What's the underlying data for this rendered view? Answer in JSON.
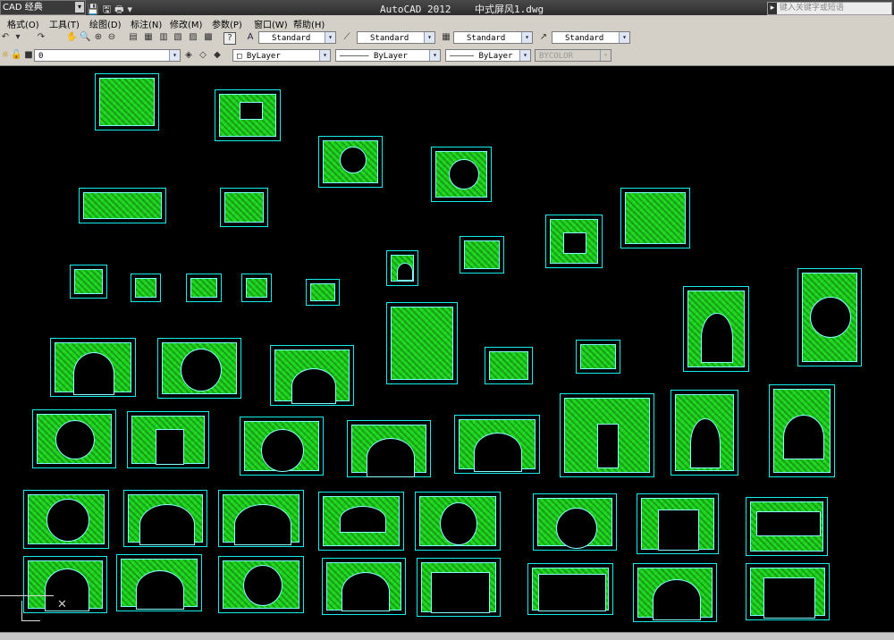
{
  "titlebar": {
    "workspace": "CAD 经典",
    "workspace_arrow": "▾",
    "quick_access": "💾🖫🖶▾",
    "app_title": "AutoCAD 2012",
    "doc_title": "中式屏风1.dwg",
    "search_arrow": "▸",
    "search_placeholder": "键入关键字或短语"
  },
  "menu": {
    "items": [
      "格式(O)",
      "工具(T)",
      "绘图(D)",
      "标注(N)",
      "修改(M)",
      "参数(P)",
      "窗口(W)",
      "帮助(H)"
    ]
  },
  "styles_toolbar": {
    "text_style": "Standard",
    "dim_style": "Standard",
    "table_style": "Standard",
    "mleader_style": "Standard"
  },
  "layers_toolbar": {
    "layer": "0",
    "color": "ByLayer",
    "linetype": "ByLayer",
    "lineweight": "ByLayer",
    "plotstyle": "BYCOLOR"
  },
  "canvas": {
    "background": "#000000",
    "line_color": "#00ff00",
    "outline_color": "#00ffff"
  }
}
